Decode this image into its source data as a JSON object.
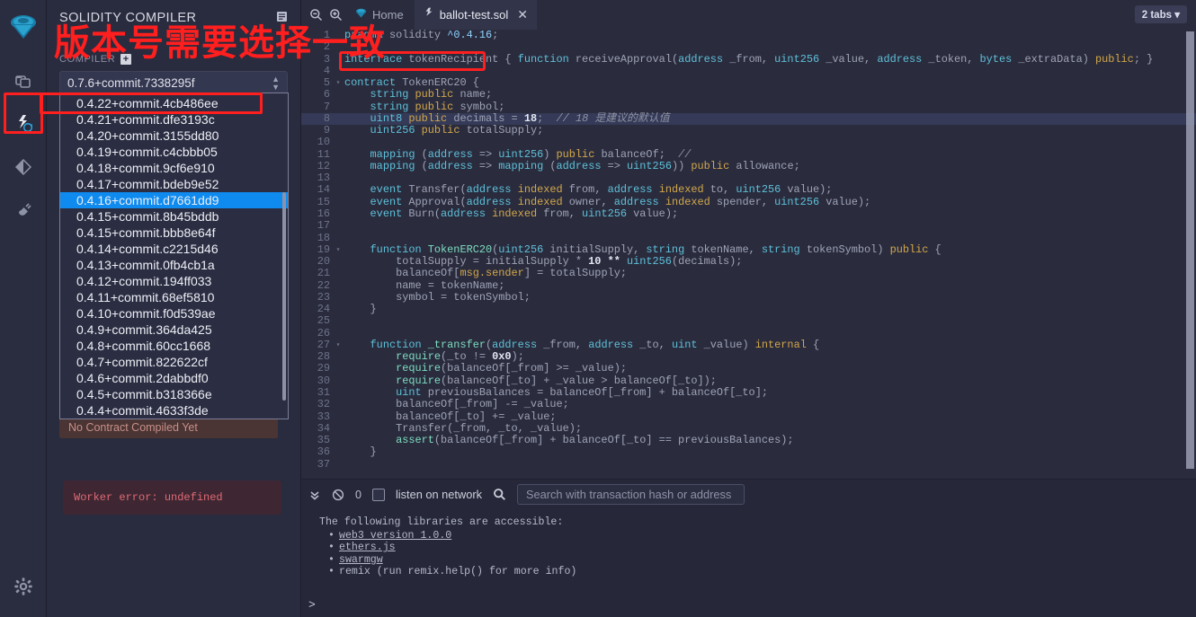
{
  "annotation": {
    "text": "版本号需要选择一致",
    "color": "#ff1f1f"
  },
  "rail": {
    "items": [
      {
        "name": "remix-logo",
        "label": "Remix"
      },
      {
        "name": "file-explorer",
        "label": "File explorers"
      },
      {
        "name": "solidity-compiler",
        "label": "Solidity compiler"
      },
      {
        "name": "deploy-run",
        "label": "Deploy & run transactions"
      },
      {
        "name": "plugin-manager",
        "label": "Plugin manager"
      },
      {
        "name": "settings",
        "label": "Settings"
      }
    ]
  },
  "panel": {
    "title": "SOLIDITY COMPILER",
    "compiler_label": "COMPILER",
    "selected_version": "0.7.6+commit.7338295f",
    "versions": [
      "0.4.22+commit.4cb486ee",
      "0.4.21+commit.dfe3193c",
      "0.4.20+commit.3155dd80",
      "0.4.19+commit.c4cbbb05",
      "0.4.18+commit.9cf6e910",
      "0.4.17+commit.bdeb9e52",
      "0.4.16+commit.d7661dd9",
      "0.4.15+commit.8b45bddb",
      "0.4.15+commit.bbb8e64f",
      "0.4.14+commit.c2215d46",
      "0.4.13+commit.0fb4cb1a",
      "0.4.12+commit.194ff033",
      "0.4.11+commit.68ef5810",
      "0.4.10+commit.f0d539ae",
      "0.4.9+commit.364da425",
      "0.4.8+commit.60cc1668",
      "0.4.7+commit.822622cf",
      "0.4.6+commit.2dabbdf0",
      "0.4.5+commit.b318366e",
      "0.4.4+commit.4633f3de"
    ],
    "highlighted_version": "0.4.16+commit.d7661dd9",
    "no_contract_text": "No Contract Compiled Yet",
    "worker_error": "Worker error: undefined"
  },
  "editor": {
    "home_tab": "Home",
    "file_tab": "ballot-test.sol",
    "tabs_count_label": "2 tabs",
    "lines": [
      {
        "n": 1,
        "fold": "",
        "hl": false,
        "tokens": [
          {
            "t": "pragma ",
            "c": "kw"
          },
          {
            "t": "solidity ",
            "c": "nm"
          },
          {
            "t": "^0.4.16",
            "c": "lt"
          },
          {
            "t": ";",
            "c": "nm"
          }
        ]
      },
      {
        "n": 2,
        "fold": "",
        "hl": false,
        "tokens": []
      },
      {
        "n": 3,
        "fold": "",
        "hl": false,
        "tokens": [
          {
            "t": "interface ",
            "c": "kw"
          },
          {
            "t": "tokenRecipient ",
            "c": "nm"
          },
          {
            "t": "{ ",
            "c": "nm"
          },
          {
            "t": "function ",
            "c": "kw"
          },
          {
            "t": "receiveApproval",
            "c": "nm"
          },
          {
            "t": "(",
            "c": "nm"
          },
          {
            "t": "address",
            "c": "kw"
          },
          {
            "t": " _from, ",
            "c": "nm"
          },
          {
            "t": "uint256",
            "c": "kw"
          },
          {
            "t": " _value, ",
            "c": "nm"
          },
          {
            "t": "address",
            "c": "kw"
          },
          {
            "t": " _token, ",
            "c": "nm"
          },
          {
            "t": "bytes",
            "c": "kw"
          },
          {
            "t": " _extraData",
            "c": "nm"
          },
          {
            "t": ") ",
            "c": "nm"
          },
          {
            "t": "public",
            "c": "k"
          },
          {
            "t": "; }",
            "c": "nm"
          }
        ]
      },
      {
        "n": 4,
        "fold": "",
        "hl": false,
        "tokens": []
      },
      {
        "n": 5,
        "fold": "▾",
        "hl": false,
        "tokens": [
          {
            "t": "contract ",
            "c": "kw"
          },
          {
            "t": "TokenERC20 {",
            "c": "nm"
          }
        ]
      },
      {
        "n": 6,
        "fold": "",
        "hl": false,
        "tokens": [
          {
            "t": "    string ",
            "c": "kw"
          },
          {
            "t": "public",
            "c": "k"
          },
          {
            "t": " name;",
            "c": "nm"
          }
        ]
      },
      {
        "n": 7,
        "fold": "",
        "hl": false,
        "tokens": [
          {
            "t": "    string ",
            "c": "kw"
          },
          {
            "t": "public",
            "c": "k"
          },
          {
            "t": " symbol;",
            "c": "nm"
          }
        ]
      },
      {
        "n": 8,
        "fold": "",
        "hl": true,
        "tokens": [
          {
            "t": "    uint8 ",
            "c": "kw"
          },
          {
            "t": "public",
            "c": "k"
          },
          {
            "t": " decimals = ",
            "c": "nm"
          },
          {
            "t": "18",
            "c": "num"
          },
          {
            "t": ";  ",
            "c": "nm"
          },
          {
            "t": "// 18 是建议的默认值",
            "c": "cm"
          }
        ]
      },
      {
        "n": 9,
        "fold": "",
        "hl": false,
        "tokens": [
          {
            "t": "    uint256 ",
            "c": "kw"
          },
          {
            "t": "public",
            "c": "k"
          },
          {
            "t": " totalSupply;",
            "c": "nm"
          }
        ]
      },
      {
        "n": 10,
        "fold": "",
        "hl": false,
        "tokens": []
      },
      {
        "n": 11,
        "fold": "",
        "hl": false,
        "tokens": [
          {
            "t": "    mapping ",
            "c": "kw"
          },
          {
            "t": "(",
            "c": "nm"
          },
          {
            "t": "address",
            "c": "kw"
          },
          {
            "t": " => ",
            "c": "nm"
          },
          {
            "t": "uint256",
            "c": "kw"
          },
          {
            "t": ") ",
            "c": "nm"
          },
          {
            "t": "public",
            "c": "k"
          },
          {
            "t": " balanceOf;  ",
            "c": "nm"
          },
          {
            "t": "//",
            "c": "cm"
          }
        ]
      },
      {
        "n": 12,
        "fold": "",
        "hl": false,
        "tokens": [
          {
            "t": "    mapping ",
            "c": "kw"
          },
          {
            "t": "(",
            "c": "nm"
          },
          {
            "t": "address",
            "c": "kw"
          },
          {
            "t": " => ",
            "c": "nm"
          },
          {
            "t": "mapping ",
            "c": "kw"
          },
          {
            "t": "(",
            "c": "nm"
          },
          {
            "t": "address",
            "c": "kw"
          },
          {
            "t": " => ",
            "c": "nm"
          },
          {
            "t": "uint256",
            "c": "kw"
          },
          {
            "t": ")) ",
            "c": "nm"
          },
          {
            "t": "public",
            "c": "k"
          },
          {
            "t": " allowance;",
            "c": "nm"
          }
        ]
      },
      {
        "n": 13,
        "fold": "",
        "hl": false,
        "tokens": []
      },
      {
        "n": 14,
        "fold": "",
        "hl": false,
        "tokens": [
          {
            "t": "    event ",
            "c": "kw"
          },
          {
            "t": "Transfer(",
            "c": "nm"
          },
          {
            "t": "address ",
            "c": "kw"
          },
          {
            "t": "indexed",
            "c": "k"
          },
          {
            "t": " from, ",
            "c": "nm"
          },
          {
            "t": "address ",
            "c": "kw"
          },
          {
            "t": "indexed",
            "c": "k"
          },
          {
            "t": " to, ",
            "c": "nm"
          },
          {
            "t": "uint256",
            "c": "kw"
          },
          {
            "t": " value);",
            "c": "nm"
          }
        ]
      },
      {
        "n": 15,
        "fold": "",
        "hl": false,
        "tokens": [
          {
            "t": "    event ",
            "c": "kw"
          },
          {
            "t": "Approval(",
            "c": "nm"
          },
          {
            "t": "address ",
            "c": "kw"
          },
          {
            "t": "indexed",
            "c": "k"
          },
          {
            "t": " owner, ",
            "c": "nm"
          },
          {
            "t": "address ",
            "c": "kw"
          },
          {
            "t": "indexed",
            "c": "k"
          },
          {
            "t": " spender, ",
            "c": "nm"
          },
          {
            "t": "uint256",
            "c": "kw"
          },
          {
            "t": " value);",
            "c": "nm"
          }
        ]
      },
      {
        "n": 16,
        "fold": "",
        "hl": false,
        "tokens": [
          {
            "t": "    event ",
            "c": "kw"
          },
          {
            "t": "Burn(",
            "c": "nm"
          },
          {
            "t": "address ",
            "c": "kw"
          },
          {
            "t": "indexed",
            "c": "k"
          },
          {
            "t": " from, ",
            "c": "nm"
          },
          {
            "t": "uint256",
            "c": "kw"
          },
          {
            "t": " value);",
            "c": "nm"
          }
        ]
      },
      {
        "n": 17,
        "fold": "",
        "hl": false,
        "tokens": []
      },
      {
        "n": 18,
        "fold": "",
        "hl": false,
        "tokens": []
      },
      {
        "n": 19,
        "fold": "▾",
        "hl": false,
        "tokens": [
          {
            "t": "    function ",
            "c": "kw"
          },
          {
            "t": "TokenERC20",
            "c": "fn"
          },
          {
            "t": "(",
            "c": "nm"
          },
          {
            "t": "uint256",
            "c": "kw"
          },
          {
            "t": " initialSupply, ",
            "c": "nm"
          },
          {
            "t": "string",
            "c": "kw"
          },
          {
            "t": " tokenName, ",
            "c": "nm"
          },
          {
            "t": "string",
            "c": "kw"
          },
          {
            "t": " tokenSymbol) ",
            "c": "nm"
          },
          {
            "t": "public",
            "c": "k"
          },
          {
            "t": " {",
            "c": "nm"
          }
        ]
      },
      {
        "n": 20,
        "fold": "",
        "hl": false,
        "tokens": [
          {
            "t": "        totalSupply = initialSupply * ",
            "c": "nm"
          },
          {
            "t": "10",
            "c": "num"
          },
          {
            "t": " ** ",
            "c": "num"
          },
          {
            "t": "uint256",
            "c": "kw"
          },
          {
            "t": "(decimals);",
            "c": "nm"
          }
        ]
      },
      {
        "n": 21,
        "fold": "",
        "hl": false,
        "tokens": [
          {
            "t": "        balanceOf[",
            "c": "nm"
          },
          {
            "t": "msg.sender",
            "c": "k"
          },
          {
            "t": "] = totalSupply;",
            "c": "nm"
          }
        ]
      },
      {
        "n": 22,
        "fold": "",
        "hl": false,
        "tokens": [
          {
            "t": "        name = tokenName;",
            "c": "nm"
          }
        ]
      },
      {
        "n": 23,
        "fold": "",
        "hl": false,
        "tokens": [
          {
            "t": "        symbol = tokenSymbol;",
            "c": "nm"
          }
        ]
      },
      {
        "n": 24,
        "fold": "",
        "hl": false,
        "tokens": [
          {
            "t": "    }",
            "c": "nm"
          }
        ]
      },
      {
        "n": 25,
        "fold": "",
        "hl": false,
        "tokens": []
      },
      {
        "n": 26,
        "fold": "",
        "hl": false,
        "tokens": []
      },
      {
        "n": 27,
        "fold": "▾",
        "hl": false,
        "tokens": [
          {
            "t": "    function ",
            "c": "kw"
          },
          {
            "t": "_transfer",
            "c": "fn"
          },
          {
            "t": "(",
            "c": "nm"
          },
          {
            "t": "address",
            "c": "kw"
          },
          {
            "t": " _from, ",
            "c": "nm"
          },
          {
            "t": "address",
            "c": "kw"
          },
          {
            "t": " _to, ",
            "c": "nm"
          },
          {
            "t": "uint",
            "c": "kw"
          },
          {
            "t": " _value) ",
            "c": "nm"
          },
          {
            "t": "internal",
            "c": "k"
          },
          {
            "t": " {",
            "c": "nm"
          }
        ]
      },
      {
        "n": 28,
        "fold": "",
        "hl": false,
        "tokens": [
          {
            "t": "        require",
            "c": "fn"
          },
          {
            "t": "(_to != ",
            "c": "nm"
          },
          {
            "t": "0x0",
            "c": "num"
          },
          {
            "t": ");",
            "c": "nm"
          }
        ]
      },
      {
        "n": 29,
        "fold": "",
        "hl": false,
        "tokens": [
          {
            "t": "        require",
            "c": "fn"
          },
          {
            "t": "(balanceOf[_from] >= _value);",
            "c": "nm"
          }
        ]
      },
      {
        "n": 30,
        "fold": "",
        "hl": false,
        "tokens": [
          {
            "t": "        require",
            "c": "fn"
          },
          {
            "t": "(balanceOf[_to] + _value > balanceOf[_to]);",
            "c": "nm"
          }
        ]
      },
      {
        "n": 31,
        "fold": "",
        "hl": false,
        "tokens": [
          {
            "t": "        uint",
            "c": "kw"
          },
          {
            "t": " previousBalances = balanceOf[_from] + balanceOf[_to];",
            "c": "nm"
          }
        ]
      },
      {
        "n": 32,
        "fold": "",
        "hl": false,
        "tokens": [
          {
            "t": "        balanceOf[_from] -= _value;",
            "c": "nm"
          }
        ]
      },
      {
        "n": 33,
        "fold": "",
        "hl": false,
        "tokens": [
          {
            "t": "        balanceOf[_to] += _value;",
            "c": "nm"
          }
        ]
      },
      {
        "n": 34,
        "fold": "",
        "hl": false,
        "tokens": [
          {
            "t": "        Transfer(_from, _to, _value);",
            "c": "nm"
          }
        ]
      },
      {
        "n": 35,
        "fold": "",
        "hl": false,
        "tokens": [
          {
            "t": "        assert",
            "c": "fn"
          },
          {
            "t": "(balanceOf[_from] + balanceOf[_to] == previousBalances);",
            "c": "nm"
          }
        ]
      },
      {
        "n": 36,
        "fold": "",
        "hl": false,
        "tokens": [
          {
            "t": "    }",
            "c": "nm"
          }
        ]
      },
      {
        "n": 37,
        "fold": "",
        "hl": false,
        "tokens": []
      }
    ]
  },
  "terminal": {
    "pending_count": "0",
    "listen_label": "listen on network",
    "search_placeholder": "Search with transaction hash or address",
    "intro": "The following libraries are accessible:",
    "libraries": [
      {
        "text": "web3 version 1.0.0",
        "link": true
      },
      {
        "text": "ethers.js",
        "link": true
      },
      {
        "text": "swarmgw",
        "link": true
      },
      {
        "text": "remix (run remix.help() for more info)",
        "link": false
      }
    ],
    "prompt": ">"
  }
}
